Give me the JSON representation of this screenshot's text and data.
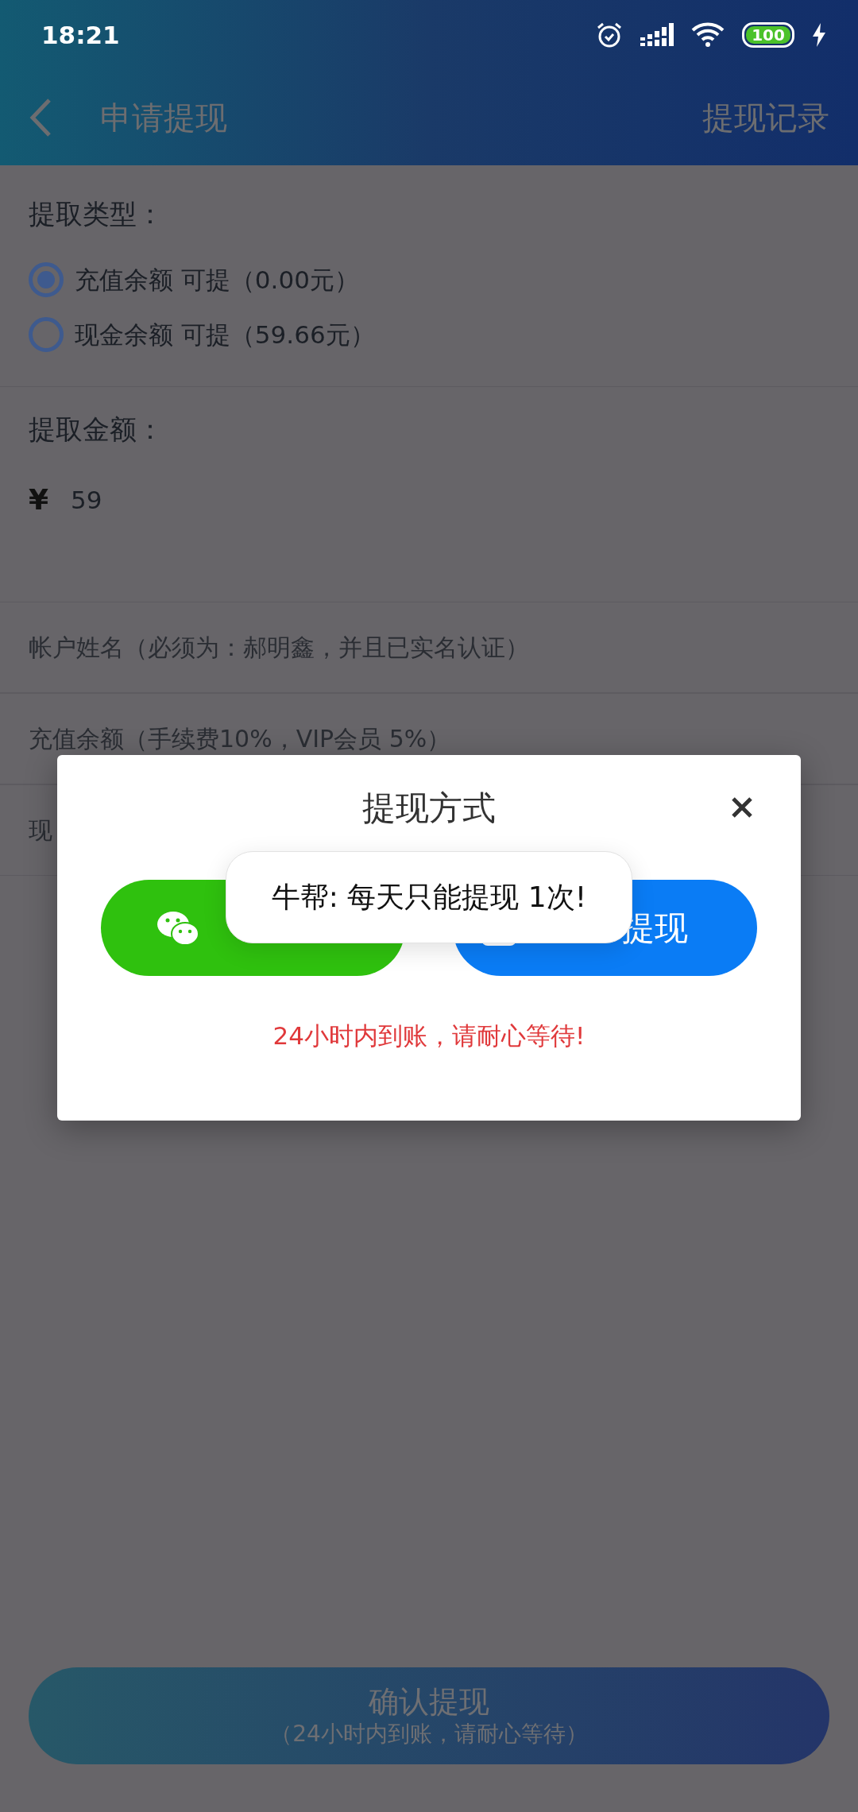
{
  "status_bar": {
    "time": "18:21",
    "battery": "100"
  },
  "header": {
    "title": "申请提现",
    "action": "提现记录"
  },
  "withdraw_type": {
    "label": "提取类型：",
    "options": [
      {
        "text": "充值余额 可提（0.00元）",
        "selected": true
      },
      {
        "text": "现金余额 可提（59.66元）",
        "selected": false
      }
    ]
  },
  "amount": {
    "label": "提取金额：",
    "currency": "¥",
    "value": "59"
  },
  "fields": [
    {
      "placeholder": "帐户姓名（必须为：郝明鑫，并且已实名认证）"
    },
    {
      "placeholder": "充值余额（手续费10%，VIP会员 5%）"
    },
    {
      "placeholder": "现"
    }
  ],
  "dialog": {
    "title": "提现方式",
    "buttons": [
      {
        "kind": "wechat"
      },
      {
        "kind": "alipay",
        "label": "提现"
      }
    ],
    "note": "24小时内到账，请耐心等待!"
  },
  "toast": "牛帮: 每天只能提现 1次!",
  "submit": {
    "label": "确认提现",
    "sublabel": "（24小时内到账，请耐心等待）"
  }
}
